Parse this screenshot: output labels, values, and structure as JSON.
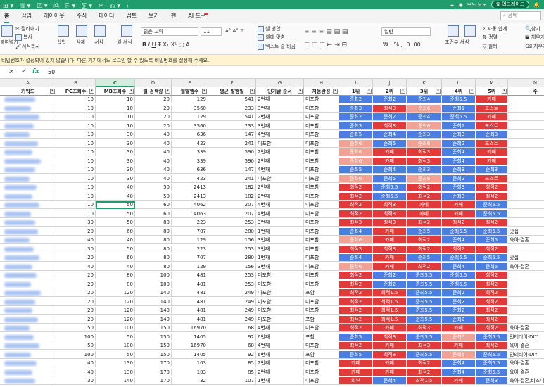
{
  "titlebar": {
    "quick_tools": "⊞▾ 🖫▾ ☑▾ ⎙ ⎘▾ ⅀▾ ✂ ⎌▾ ⁝",
    "user": "보노 보노",
    "upgrade": "업그레이드"
  },
  "menus": [
    "홈",
    "삽입",
    "레이아웃",
    "수식",
    "데이터",
    "검토",
    "보기",
    "펜",
    "AI 도구"
  ],
  "search": {
    "placeholder": "검색"
  },
  "ribbon": {
    "cut": "잘라내기",
    "copy": "복사",
    "format_copy": "서식복사",
    "paste": "붙여넣기",
    "insert": "삽입",
    "delete": "삭제",
    "format": "서식",
    "cell_style": "셀 서식",
    "font_name": "맑은 고딕",
    "font_size": "11",
    "merge": "셀 병합",
    "fit": "셀에 맞춤",
    "wrap": "텍스트 줄 바꿈",
    "number_format": "일반",
    "conditional": "조건부 서식",
    "autosum": "자동 합계",
    "sort": "정렬",
    "filter": "필터",
    "find": "찾기",
    "fill": "채우기",
    "clear": "지우기"
  },
  "infobar": {
    "text": "비밀번호가 설정되어 있지 않습니다. 다른 기기에서도 로그인 할 수 있도록 비밀번호를 설정해 주세요."
  },
  "formula": {
    "value": "50"
  },
  "columns": [
    "A",
    "B",
    "C",
    "D",
    "E",
    "F",
    "G",
    "H",
    "I",
    "J",
    "K",
    "L",
    "M",
    "N"
  ],
  "headers": [
    "키워드",
    "PC조회수",
    "MB조회수",
    "월 검색량",
    "월발행수",
    "평균 발행일",
    "인기글 순서",
    "자동완성",
    "1위",
    "2위",
    "3위",
    "4위",
    "5위",
    "주"
  ],
  "colors": {
    "blue": "#4a7ee0",
    "red": "#e03a3a",
    "pink": "#f2a294",
    "accent": "#1f9d6b"
  },
  "rows": [
    [
      10,
      10,
      20,
      129,
      541,
      "2번째",
      "미포함",
      "준최2",
      "준최2",
      "준최4",
      "준최5.5",
      "카페",
      ""
    ],
    [
      10,
      10,
      20,
      3560,
      233,
      "3번째",
      "미포함",
      "준최3",
      "최적3",
      "준최6",
      "준최1",
      "포스트",
      ""
    ],
    [
      10,
      10,
      20,
      129,
      541,
      "2번째",
      "미포함",
      "준최2",
      "준최2",
      "준최4",
      "준최5.5",
      "카페",
      ""
    ],
    [
      10,
      10,
      20,
      3560,
      233,
      "3번째",
      "미포함",
      "준최3",
      "최적3",
      "준최6",
      "준최1",
      "포스트",
      ""
    ],
    [
      10,
      30,
      40,
      636,
      147,
      "4번째",
      "미포함",
      "준최5",
      "준최4",
      "준최3",
      "준최3",
      "준최3",
      ""
    ],
    [
      10,
      30,
      40,
      423,
      241,
      "미포함",
      "미포함",
      "준최6",
      "준최5",
      "준최6",
      "준최2",
      "포스트",
      ""
    ],
    [
      10,
      30,
      40,
      339,
      590,
      "2번째",
      "미포함",
      "준최6",
      "카페",
      "최적3",
      "준최4",
      "카페",
      ""
    ],
    [
      10,
      30,
      40,
      339,
      590,
      "2번째",
      "미포함",
      "준최6",
      "카페",
      "최적3",
      "준최4",
      "카페",
      ""
    ],
    [
      10,
      30,
      40,
      636,
      147,
      "4번째",
      "미포함",
      "준최5",
      "준최4",
      "준최3",
      "준최3",
      "준최3",
      ""
    ],
    [
      10,
      30,
      40,
      423,
      241,
      "미포함",
      "미포함",
      "준최6",
      "준최5",
      "준최6",
      "준최2",
      "포스트",
      ""
    ],
    [
      10,
      40,
      50,
      2413,
      182,
      "2번째",
      "미포함",
      "최적2",
      "준최5.5",
      "최적2",
      "준최3",
      "최적2",
      ""
    ],
    [
      10,
      40,
      50,
      2413,
      182,
      "2번째",
      "미포함",
      "최적2",
      "준최5.5",
      "최적2",
      "준최3",
      "최적2",
      ""
    ],
    [
      10,
      50,
      60,
      4062,
      207,
      "4번째",
      "미포함",
      "최적2",
      "최적3",
      "카페",
      "카페",
      "준최5.5",
      ""
    ],
    [
      10,
      50,
      60,
      4063,
      207,
      "4번째",
      "미포함",
      "최적2",
      "최적3",
      "카페",
      "카페",
      "준최5.5",
      ""
    ],
    [
      30,
      50,
      80,
      223,
      253,
      "3번째",
      "미포함",
      "최적3",
      "최적3",
      "최적2",
      "최적2",
      "최적2",
      ""
    ],
    [
      20,
      60,
      80,
      707,
      280,
      "1번째",
      "미포함",
      "준최4",
      "카페",
      "준최5",
      "준최5.5",
      "준최5.5",
      "맛집"
    ],
    [
      40,
      40,
      80,
      129,
      156,
      "3번째",
      "미포함",
      "준최6",
      "카페",
      "최적2",
      "준최4",
      "준최5",
      "육아·결혼"
    ],
    [
      30,
      50,
      80,
      223,
      253,
      "3번째",
      "미포함",
      "최적3",
      "최적3",
      "최적2",
      "최적2",
      "최적2",
      ""
    ],
    [
      20,
      60,
      80,
      707,
      280,
      "1번째",
      "미포함",
      "준최4",
      "카페",
      "준최5",
      "준최5.5",
      "준최5.5",
      "맛집"
    ],
    [
      40,
      40,
      80,
      129,
      156,
      "3번째",
      "미포함",
      "준최6",
      "카페",
      "최적2",
      "준최4",
      "준최5",
      "육아·결혼"
    ],
    [
      20,
      80,
      100,
      481,
      253,
      "미포함",
      "미포함",
      "최적2",
      "준최2",
      "준최5.5",
      "준최5.5",
      "최적2",
      ""
    ],
    [
      20,
      80,
      100,
      481,
      253,
      "미포함",
      "미포함",
      "최적2",
      "준최2",
      "준최5.5",
      "준최5.5",
      "최적2",
      ""
    ],
    [
      20,
      120,
      140,
      481,
      249,
      "미포함",
      "포함",
      "최적2",
      "최적1.5",
      "준최5.5",
      "준최2",
      "최적2",
      ""
    ],
    [
      20,
      120,
      140,
      481,
      249,
      "미포함",
      "미포함",
      "최적2",
      "최적1.5",
      "준최5.5",
      "준최2",
      "최적2",
      ""
    ],
    [
      20,
      120,
      140,
      481,
      249,
      "미포함",
      "미포함",
      "최적2",
      "최적1.5",
      "준최5.5",
      "준최2",
      "최적2",
      ""
    ],
    [
      20,
      120,
      140,
      481,
      249,
      "미포함",
      "포함",
      "최적2",
      "최적1.5",
      "준최5.5",
      "준최2",
      "최적2",
      ""
    ],
    [
      50,
      100,
      150,
      16970,
      68,
      "4번째",
      "미포함",
      "최적2",
      "카페",
      "최적3",
      "카페",
      "최적2",
      "육아·결혼"
    ],
    [
      100,
      50,
      150,
      1405,
      92,
      "6번째",
      "포함",
      "준최5",
      "최적3",
      "준최5.5",
      "준최6",
      "준최5.5",
      "인테리어·DIY"
    ],
    [
      50,
      100,
      150,
      16970,
      68,
      "4번째",
      "미포함",
      "최적2",
      "카페",
      "최적3",
      "카페",
      "최적2",
      "육아·결혼"
    ],
    [
      100,
      50,
      150,
      1405,
      92,
      "6번째",
      "포함",
      "준최5",
      "최적3",
      "준최5.5",
      "준최6",
      "준최5.5",
      "인테리어·DIY"
    ],
    [
      40,
      130,
      170,
      103,
      85,
      "2번째",
      "미포함",
      "카페",
      "카페",
      "최적2",
      "준최4",
      "준최5.5",
      "육아·결혼"
    ],
    [
      40,
      130,
      170,
      103,
      85,
      "2번째",
      "미포함",
      "카페",
      "카페",
      "최적2",
      "준최4",
      "준최5.5",
      "육아·결혼"
    ],
    [
      30,
      140,
      170,
      32,
      107,
      "1번째",
      "미포함",
      "외부",
      "준최4",
      "최적1.5",
      "카페",
      "준최3",
      "육아·결혼,비즈니스"
    ]
  ],
  "selected_cell": {
    "row": 12,
    "col": "C"
  }
}
